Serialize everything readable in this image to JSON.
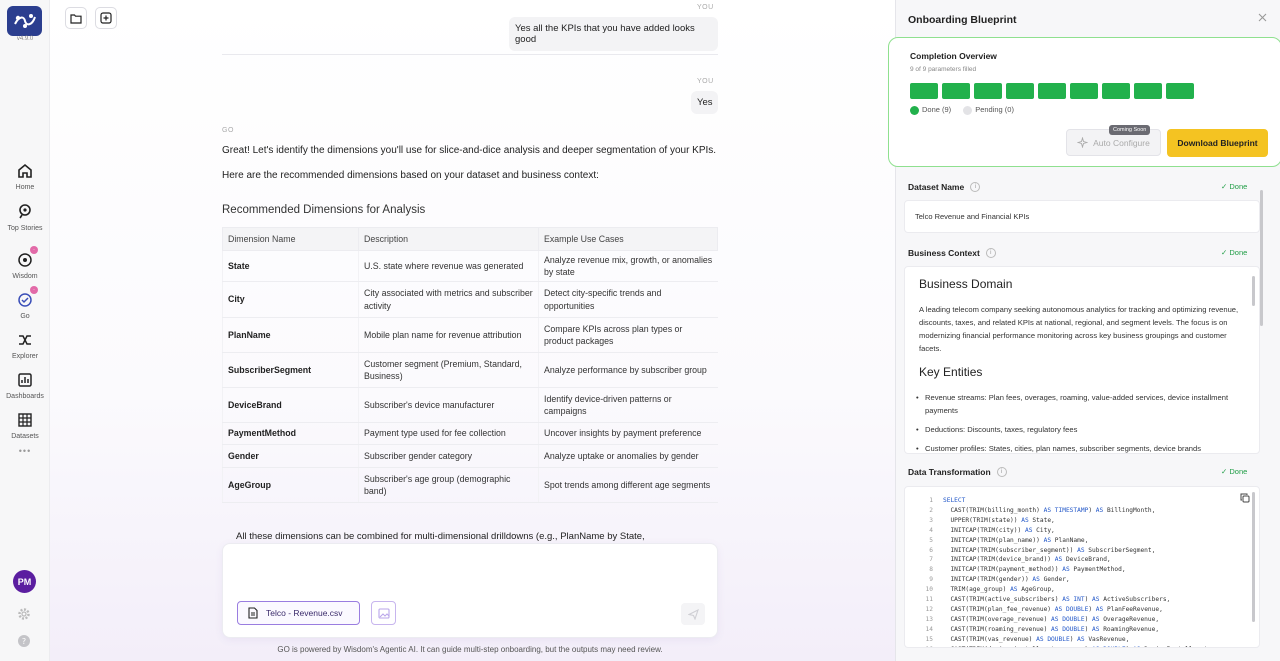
{
  "app": {
    "version": "v4.9.0"
  },
  "nav": {
    "items": [
      {
        "label": "Home",
        "icon": "home-icon"
      },
      {
        "label": "Top Stories",
        "icon": "search-stories-icon"
      },
      {
        "label": "Wisdom",
        "icon": "wisdom-icon"
      },
      {
        "label": "Go",
        "icon": "go-icon"
      },
      {
        "label": "Explorer",
        "icon": "explorer-icon"
      },
      {
        "label": "Dashboards",
        "icon": "dashboards-icon"
      },
      {
        "label": "Datasets",
        "icon": "datasets-icon"
      }
    ],
    "more": "•••",
    "avatar_initials": "PM"
  },
  "chat": {
    "you_label": "YOU",
    "go_label": "GO",
    "msg1": "Yes all the KPIs that you have added looks good",
    "msg2": "Yes",
    "reply_p1": "Great! Let's identify the dimensions you'll use for slice-and-dice analysis and deeper segmentation of your KPIs.",
    "reply_p2": "Here are the recommended dimensions based on your dataset and business context:",
    "heading": "Recommended Dimensions for Analysis",
    "table": {
      "headers": [
        "Dimension Name",
        "Description",
        "Example Use Cases"
      ],
      "rows": [
        [
          "State",
          "U.S. state where revenue was generated",
          "Analyze revenue mix, growth, or anomalies by state"
        ],
        [
          "City",
          "City associated with metrics and subscriber activity",
          "Detect city-specific trends and opportunities"
        ],
        [
          "PlanName",
          "Mobile plan name for revenue attribution",
          "Compare KPIs across plan types or product packages"
        ],
        [
          "SubscriberSegment",
          "Customer segment (Premium, Standard, Business)",
          "Analyze performance by subscriber group"
        ],
        [
          "DeviceBrand",
          "Subscriber's device manufacturer",
          "Identify device-driven patterns or campaigns"
        ],
        [
          "PaymentMethod",
          "Payment type used for fee collection",
          "Uncover insights by payment preference"
        ],
        [
          "Gender",
          "Subscriber gender category",
          "Analyze uptake or anomalies by gender"
        ],
        [
          "AgeGroup",
          "Subscriber's age group (demographic band)",
          "Spot trends among different age segments"
        ]
      ]
    },
    "bullet": "All these dimensions can be combined for multi-dimensional drilldowns (e.g., PlanName by State,",
    "attachment": "Telco - Revenue.csv",
    "disclaimer": "GO is powered by Wisdom's Agentic AI. It can guide multi-step onboarding, but the outputs may need review."
  },
  "panel": {
    "title": "Onboarding Blueprint",
    "overview": {
      "title": "Completion Overview",
      "subtitle": "9 of 9 parameters filled",
      "filled": 9,
      "total": 9,
      "done_label": "Done (9)",
      "pending_label": "Pending (0)",
      "auto_configure": "Auto Configure",
      "coming_soon": "Coming Soon",
      "download": "Download Blueprint",
      "done_color": "#22b14c",
      "accent_color": "#f4c322"
    },
    "dataset_name": {
      "label": "Dataset Name",
      "status": "Done",
      "value": "Telco Revenue and Financial KPIs"
    },
    "business_context": {
      "label": "Business Context",
      "status": "Done",
      "h_domain": "Business Domain",
      "p_domain": "A leading telecom company seeking autonomous analytics for tracking and optimizing revenue, discounts, taxes, and related KPIs at national, regional, and segment levels. The focus is on modernizing financial performance monitoring across key business groupings and customer facets.",
      "h_entities": "Key Entities",
      "entities": [
        "Revenue streams: Plan fees, overages, roaming, value-added services, device installment payments",
        "Deductions: Discounts, taxes, regulatory fees",
        "Customer profiles: States, cities, plan names, subscriber segments, device brands"
      ]
    },
    "data_transformation": {
      "label": "Data Transformation",
      "status": "Done",
      "lines": [
        [
          "1",
          "SELECT",
          ""
        ],
        [
          "2",
          "",
          "  CAST(TRIM(billing_month) AS TIMESTAMP) AS BillingMonth,"
        ],
        [
          "3",
          "",
          "  UPPER(TRIM(state)) AS State,"
        ],
        [
          "4",
          "",
          "  INITCAP(TRIM(city)) AS City,"
        ],
        [
          "5",
          "",
          "  INITCAP(TRIM(plan_name)) AS PlanName,"
        ],
        [
          "6",
          "",
          "  INITCAP(TRIM(subscriber_segment)) AS SubscriberSegment,"
        ],
        [
          "7",
          "",
          "  INITCAP(TRIM(device_brand)) AS DeviceBrand,"
        ],
        [
          "8",
          "",
          "  INITCAP(TRIM(payment_method)) AS PaymentMethod,"
        ],
        [
          "9",
          "",
          "  INITCAP(TRIM(gender)) AS Gender,"
        ],
        [
          "10",
          "",
          "  TRIM(age_group) AS AgeGroup,"
        ],
        [
          "11",
          "",
          "  CAST(TRIM(active_subscribers) AS INT) AS ActiveSubscribers,"
        ],
        [
          "12",
          "",
          "  CAST(TRIM(plan_fee_revenue) AS DOUBLE) AS PlanFeeRevenue,"
        ],
        [
          "13",
          "",
          "  CAST(TRIM(overage_revenue) AS DOUBLE) AS OverageRevenue,"
        ],
        [
          "14",
          "",
          "  CAST(TRIM(roaming_revenue) AS DOUBLE) AS RoamingRevenue,"
        ],
        [
          "15",
          "",
          "  CAST(TRIM(vas_revenue) AS DOUBLE) AS VasRevenue,"
        ],
        [
          "16",
          "",
          "  CAST(TRIM(device_installment_revenue) AS DOUBLE) AS DeviceInstallment"
        ]
      ]
    }
  }
}
